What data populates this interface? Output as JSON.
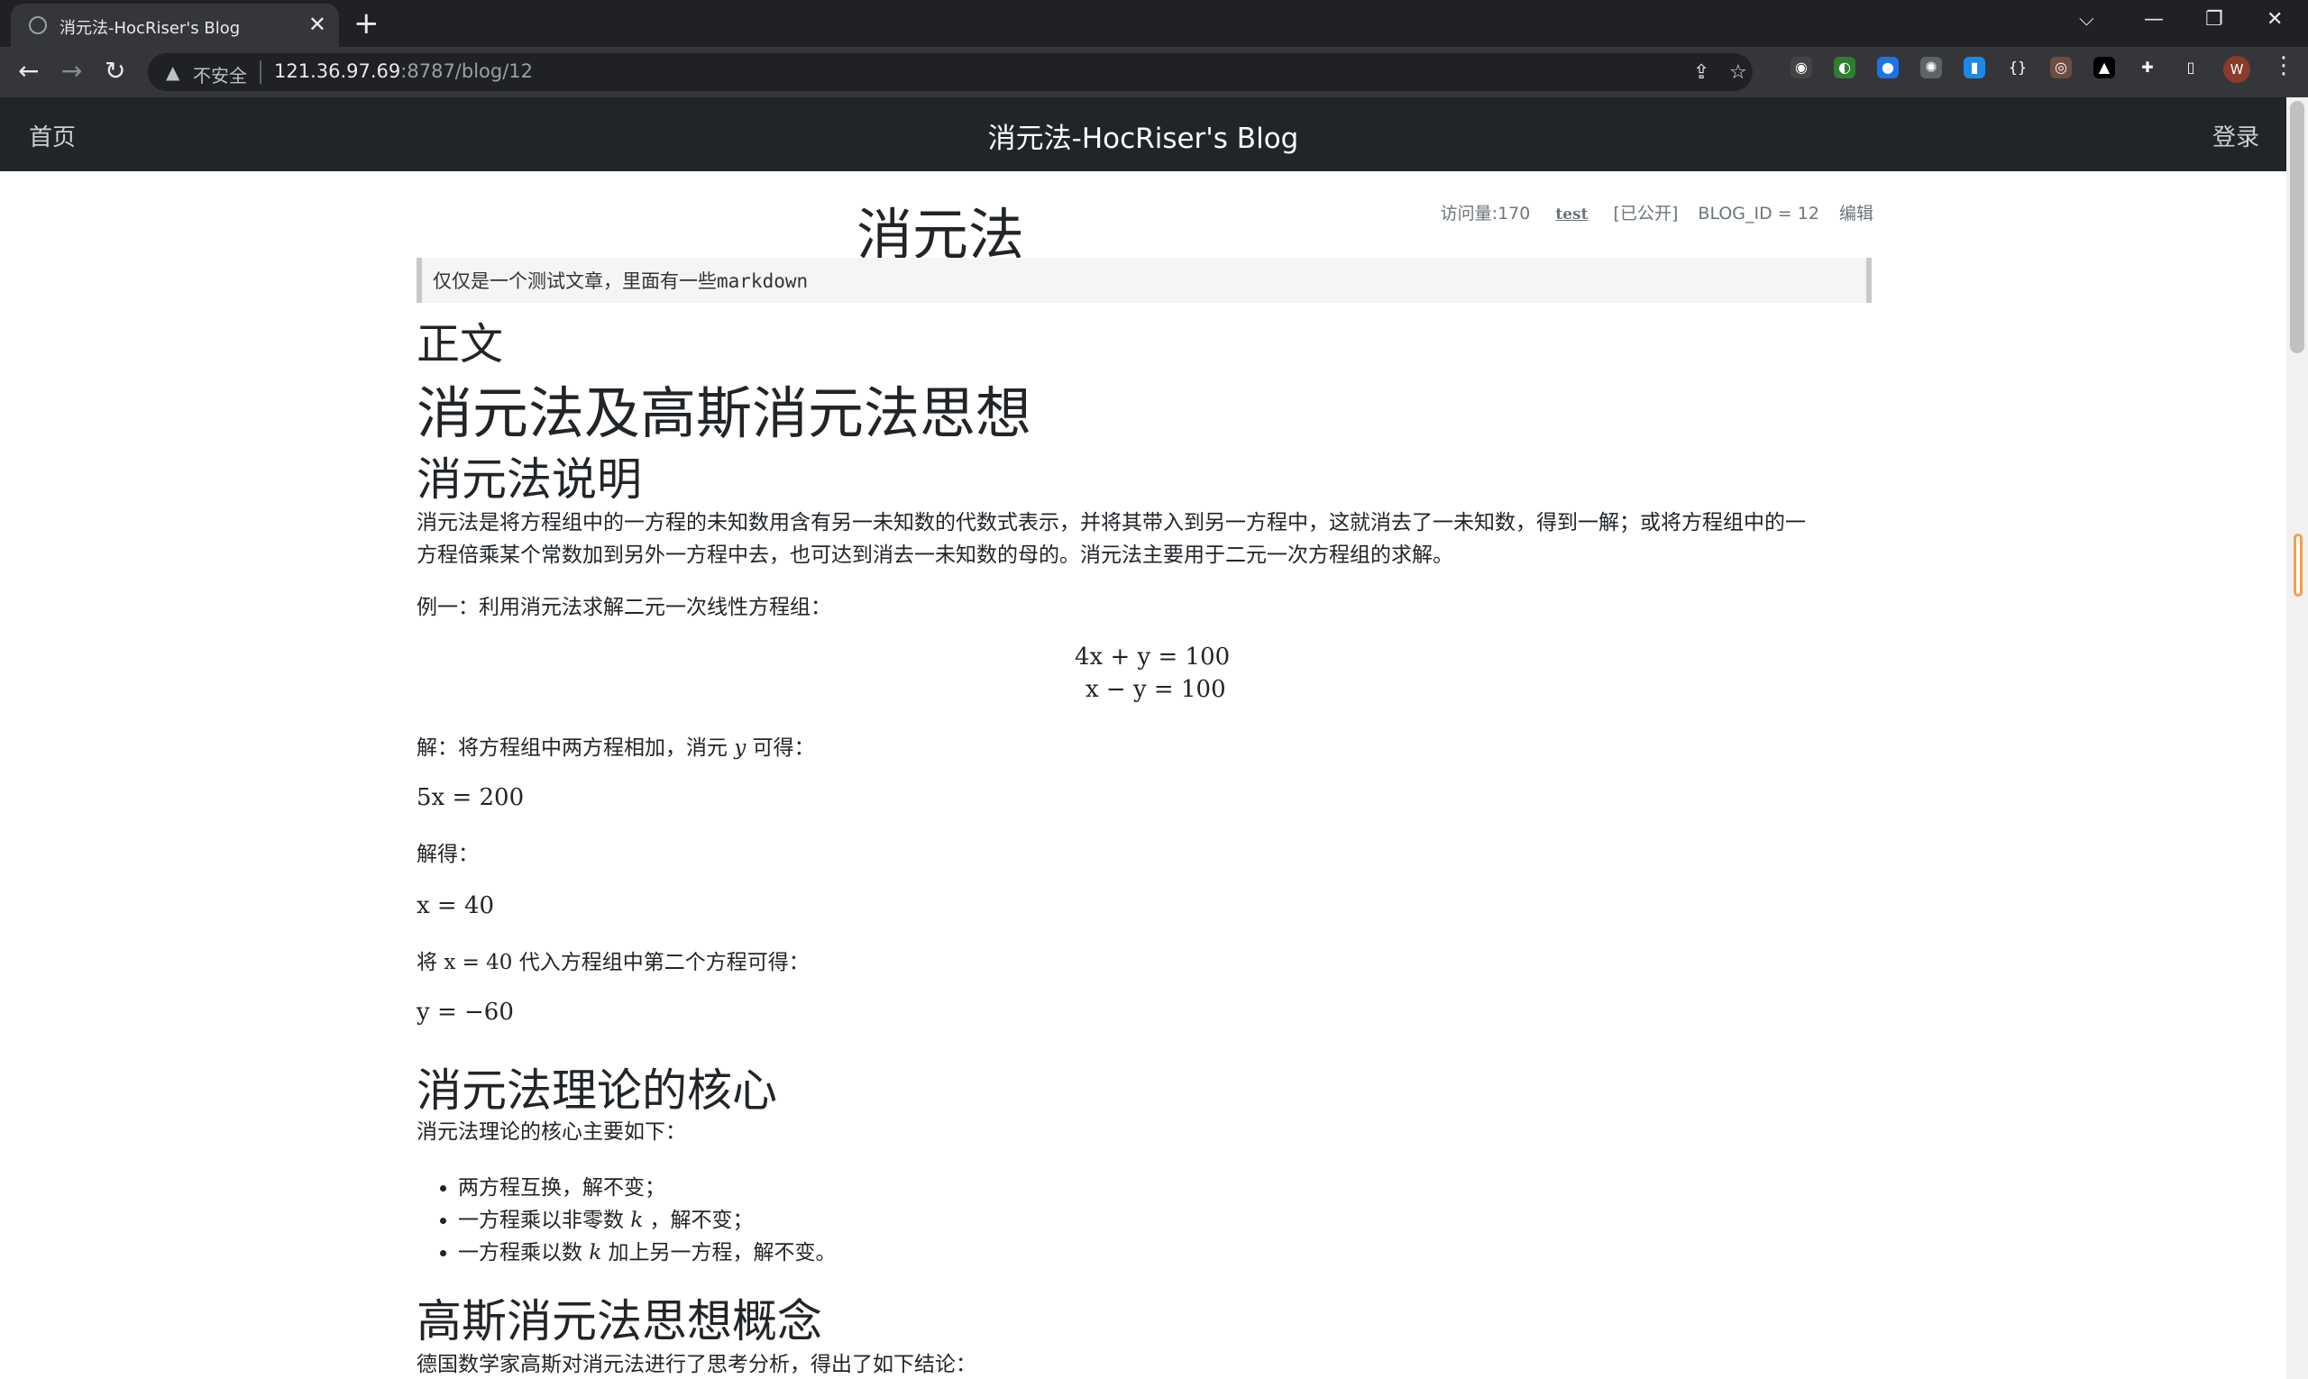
{
  "browser": {
    "tab_title": "消元法-HocRiser's Blog",
    "tab_close": "✕",
    "new_tab": "+",
    "insecure_label": "不安全",
    "url_host": "121.36.97.69",
    "url_rest": ":8787/blog/12",
    "profile_initial": "W"
  },
  "site": {
    "home": "首页",
    "brand": "消元法-HocRiser's Blog",
    "login": "登录"
  },
  "post": {
    "title": "消元法",
    "views": "访问量:170",
    "author": "test",
    "status": "[已公开]",
    "blog_id": "BLOG_ID = 12",
    "edit": "编辑",
    "summary": "仅仅是一个测试文章，里面有一些markdown"
  },
  "body": {
    "h1_main": "正文",
    "h1_topic": "消元法及高斯消元法思想",
    "h2_explain": "消元法说明",
    "para1_line1": "消元法是将方程组中的一方程的未知数用含有另一未知数的代数式表示，并将其带入到另一方程中，这就消去了一未知数，得到一解；或将方程组中的一",
    "para1_line2": "方程倍乘某个常数加到另外一方程中去，也可达到消去一未知数的母的。消元法主要用于二元一次方程组的求解。",
    "example": "例一：利用消元法求解二元一次线性方程组：",
    "eq1": "4x + y = 100",
    "eq2": "x − y = 100",
    "solve_prefix": "解：将方程组中两方程相加，消元 ",
    "solve_var": "y",
    "solve_suffix": " 可得：",
    "res1": "5x = 200",
    "solved": "解得：",
    "res2": "x = 40",
    "sub_prefix": "将 ",
    "sub_expr": "x = 40",
    "sub_suffix": " 代入方程组中第二个方程可得：",
    "res3": "y = −60",
    "h2_core": "消元法理论的核心",
    "core_intro": "消元法理论的核心主要如下：",
    "rule1": "两方程互换，解不变；",
    "rule2_prefix": "一方程乘以非零数 ",
    "rule2_var": "k",
    "rule2_suffix": " ，解不变；",
    "rule3_prefix": "一方程乘以数 ",
    "rule3_var": "k",
    "rule3_suffix": " 加上另一方程，解不变。",
    "h2_gauss": "高斯消元法思想概念",
    "gauss_intro": "德国数学家高斯对消元法进行了思考分析，得出了如下结论："
  },
  "colors": {
    "chrome_dark": "#202124",
    "toolbar": "#35363a",
    "navbar": "#212529",
    "text": "#212529",
    "muted": "#6c757d"
  }
}
